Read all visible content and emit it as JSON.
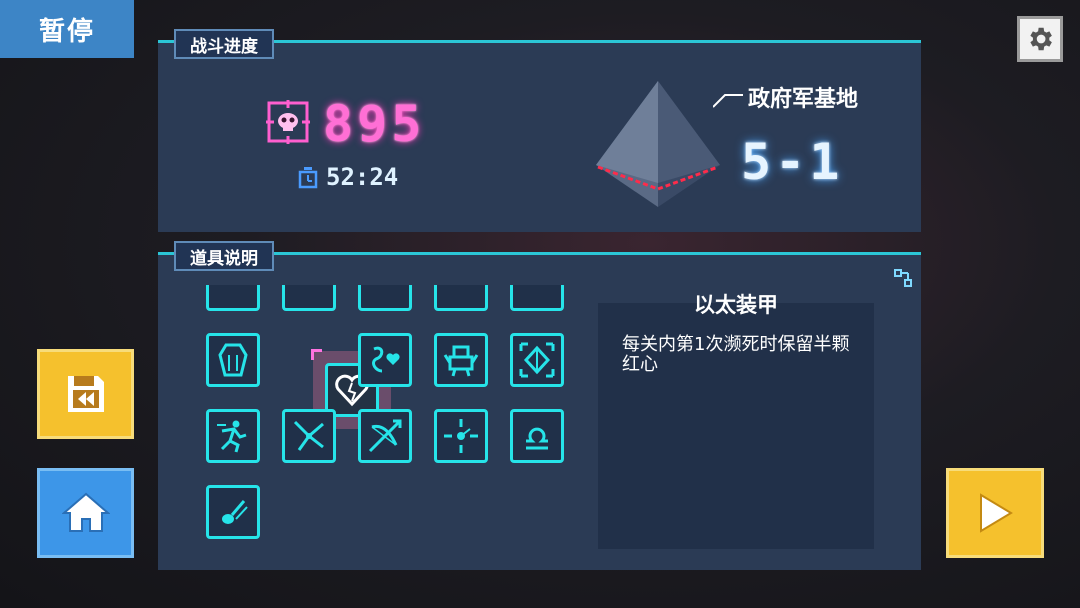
{
  "pause_label": "暂停",
  "progress": {
    "tab_label": "战斗进度",
    "kill_count": "895",
    "timer": "52:24",
    "location_name": "政府军基地",
    "stage": "5-1"
  },
  "items_panel": {
    "tab_label": "道具说明",
    "selected_item": {
      "name": "以太装甲",
      "description": "每关内第1次濒死时保留半颗红心"
    },
    "items": [
      {
        "icon": "coffin-icon"
      },
      {
        "icon": "broken-heart-icon"
      },
      {
        "icon": "snake-heart-icon"
      },
      {
        "icon": "armored-robot-icon"
      },
      {
        "icon": "expand-crystal-icon"
      },
      {
        "icon": "runner-icon"
      },
      {
        "icon": "scatter-shot-icon"
      },
      {
        "icon": "crossbow-icon"
      },
      {
        "icon": "target-cross-icon"
      },
      {
        "icon": "libra-icon"
      },
      {
        "icon": "bullet-icon"
      }
    ]
  },
  "colors": {
    "accent_cyan": "#26e4e9",
    "kill_pink": "#ff6fd5",
    "button_yellow": "#f5c12d",
    "button_blue": "#3d96e8",
    "panel_bg": "#2b3b55"
  }
}
